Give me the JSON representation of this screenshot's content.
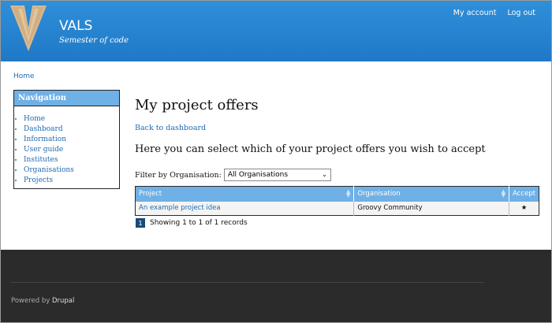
{
  "header": {
    "site_name": "VALS",
    "slogan": "Semester of code",
    "user_menu": [
      "My account",
      "Log out"
    ]
  },
  "breadcrumb": "Home",
  "sidebar": {
    "title": "Navigation",
    "items": [
      "Home",
      "Dashboard",
      "Information",
      "User guide",
      "Institutes",
      "Organisations",
      "Projects"
    ]
  },
  "main": {
    "title": "My project offers",
    "back_link": "Back to dashboard",
    "intro": "Here you can select which of your project offers you wish to accept",
    "filter": {
      "label": "Filter by Organisation:",
      "selected": "All Organisations"
    },
    "table": {
      "headers": [
        "Project",
        "Organisation",
        "Accept"
      ],
      "rows": [
        {
          "project": "An example project idea",
          "organisation": "Groovy Community",
          "accept": "★"
        }
      ]
    },
    "pager": {
      "page": "1",
      "records_text": "Showing 1 to 1 of 1 records"
    }
  },
  "footer": {
    "powered_prefix": "Powered by",
    "powered_link": "Drupal"
  },
  "colors": {
    "header_blue": "#1f78c7",
    "nav_header": "#6fb0e6",
    "link": "#1f6bb3",
    "footer": "#2b2b2b"
  }
}
